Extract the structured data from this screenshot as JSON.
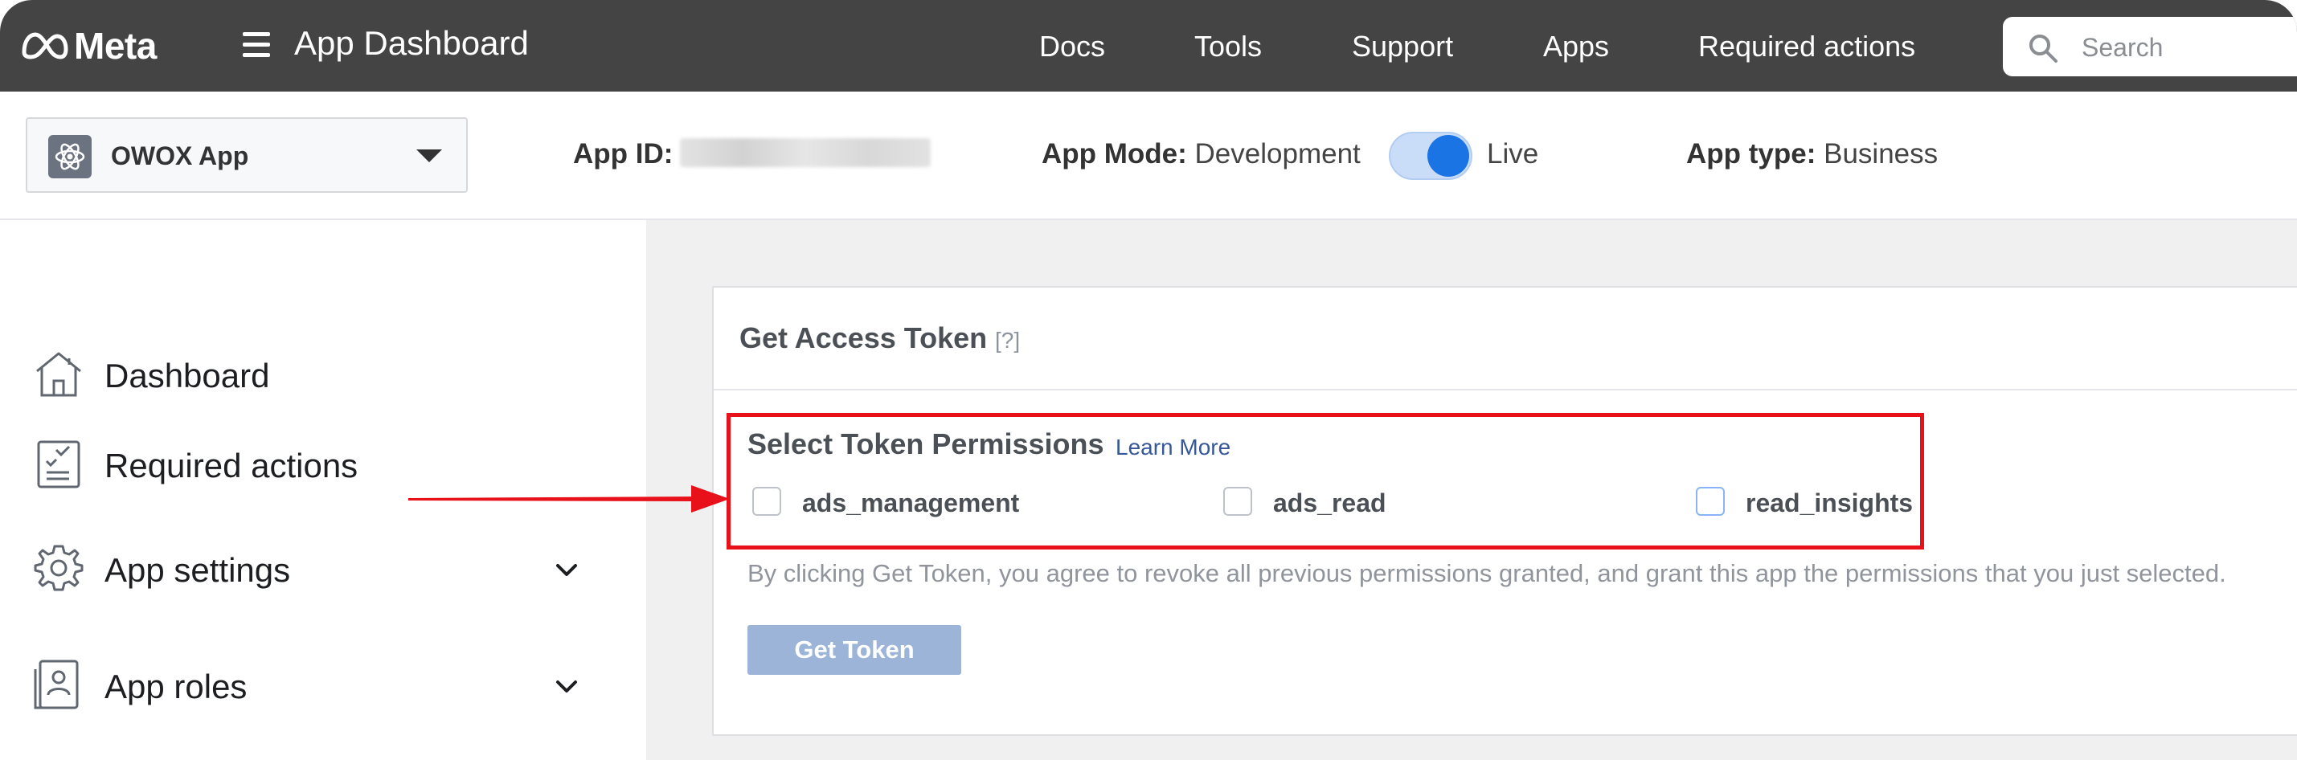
{
  "topbar": {
    "brand": "Meta",
    "title": "App Dashboard",
    "nav": [
      "Docs",
      "Tools",
      "Support",
      "Apps",
      "Required actions"
    ],
    "search_placeholder": "Search"
  },
  "appbar": {
    "app_name": "OWOX App",
    "app_id_label": "App ID:",
    "app_mode_label": "App Mode:",
    "app_mode_off": "Development",
    "app_mode_on": "Live",
    "app_mode_live": true,
    "app_type_label": "App type:",
    "app_type_value": "Business"
  },
  "sidebar": {
    "items": [
      {
        "label": "Dashboard",
        "icon": "home-icon"
      },
      {
        "label": "Required actions",
        "icon": "checklist-icon"
      },
      {
        "label": "App settings",
        "icon": "gear-icon"
      },
      {
        "label": "App roles",
        "icon": "id-badge-icon"
      }
    ]
  },
  "card": {
    "title": "Get Access Token",
    "help": "[?]",
    "permissions_title": "Select Token Permissions",
    "learn_more": "Learn More",
    "permissions": [
      {
        "label": "ads_management",
        "checked": false
      },
      {
        "label": "ads_read",
        "checked": false
      },
      {
        "label": "read_insights",
        "checked": false
      }
    ],
    "disclaimer": "By clicking Get Token, you agree to revoke all previous permissions granted, and grant this app the permissions that you just selected.",
    "button": "Get Token"
  },
  "colors": {
    "topbar": "#444444",
    "accent": "#1b74e4",
    "highlight": "#e8111a",
    "button_disabled": "#9cb4d8",
    "link": "#365899"
  }
}
